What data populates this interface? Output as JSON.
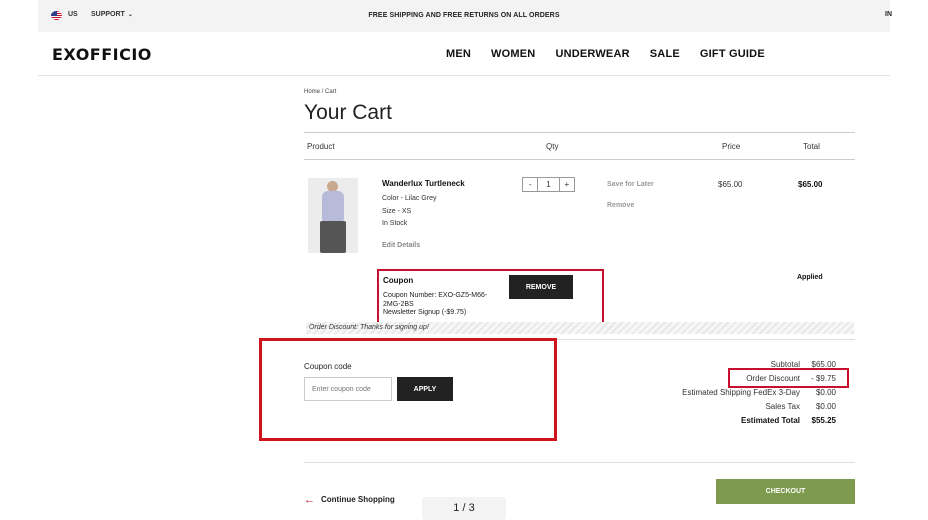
{
  "topbar": {
    "country": "US",
    "support": "SUPPORT",
    "promo": "FREE SHIPPING AND FREE RETURNS ON ALL ORDERS",
    "right": "IN"
  },
  "header": {
    "logo": "EXOFFICIO",
    "nav": [
      "MEN",
      "WOMEN",
      "UNDERWEAR",
      "SALE",
      "GIFT GUIDE"
    ]
  },
  "breadcrumb": "Home / Cart",
  "page_title": "Your Cart",
  "columns": {
    "product": "Product",
    "qty": "Qty",
    "price": "Price",
    "total": "Total"
  },
  "item": {
    "name": "Wanderlux Turtleneck",
    "color": "Color - Lilac Grey",
    "size": "Size - XS",
    "stock": "In Stock",
    "edit": "Edit Details",
    "qty_minus": "-",
    "qty": "1",
    "qty_plus": "+",
    "save_later": "Save for Later",
    "remove": "Remove",
    "price": "$65.00",
    "total": "$65.00"
  },
  "coupon_applied": {
    "title": "Coupon",
    "number": "Coupon Number: EXO-GZ5-M66-2MG-2BS",
    "desc": "Newsletter Signup (-$9.75)",
    "remove_button": "REMOVE",
    "status": "Applied",
    "discount_note": "Order Discount: Thanks for signing up!"
  },
  "coupon_form": {
    "label": "Coupon code",
    "placeholder": "Enter coupon code",
    "apply_button": "APPLY"
  },
  "summary": {
    "subtotal_label": "Subtotal",
    "subtotal": "$65.00",
    "discount_label": "Order Discount",
    "discount": "- $9.75",
    "shipping_label": "Estimated Shipping FedEx 3-Day",
    "shipping": "$0.00",
    "tax_label": "Sales Tax",
    "tax": "$0.00",
    "total_label": "Estimated Total",
    "total": "$55.25"
  },
  "footer": {
    "continue": "Continue Shopping",
    "pager": "1 / 3",
    "checkout": "CHECKOUT"
  },
  "colors": {
    "accent_red": "#c8102e",
    "checkout_green": "#7d9a4f",
    "button_dark": "#222222"
  }
}
